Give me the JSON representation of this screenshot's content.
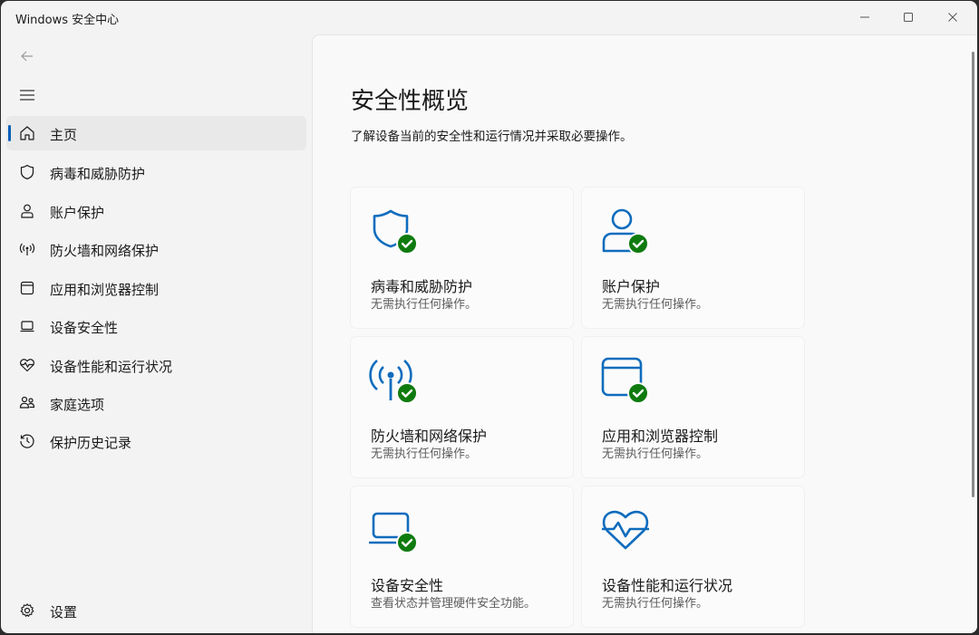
{
  "window": {
    "title": "Windows 安全中心",
    "controls": {
      "minimize": "minimize-icon",
      "maximize": "maximize-icon",
      "close": "close-icon"
    }
  },
  "nav": {
    "back_icon": "back-arrow-icon",
    "menu_icon": "hamburger-icon",
    "items": [
      {
        "label": "主页",
        "icon": "home-icon",
        "selected": true
      },
      {
        "label": "病毒和威胁防护",
        "icon": "shield-icon",
        "selected": false
      },
      {
        "label": "账户保护",
        "icon": "person-icon",
        "selected": false
      },
      {
        "label": "防火墙和网络保护",
        "icon": "antenna-icon",
        "selected": false
      },
      {
        "label": "应用和浏览器控制",
        "icon": "browser-window-icon",
        "selected": false
      },
      {
        "label": "设备安全性",
        "icon": "laptop-icon",
        "selected": false
      },
      {
        "label": "设备性能和运行状况",
        "icon": "heart-pulse-icon",
        "selected": false
      },
      {
        "label": "家庭选项",
        "icon": "family-icon",
        "selected": false
      },
      {
        "label": "保护历史记录",
        "icon": "history-icon",
        "selected": false
      }
    ],
    "settings": {
      "label": "设置",
      "icon": "gear-icon"
    }
  },
  "main": {
    "title": "安全性概览",
    "subtitle": "了解设备当前的安全性和运行情况并采取必要操作。",
    "cards": [
      {
        "title": "病毒和威胁防护",
        "status": "无需执行任何操作。",
        "icon": "shield-check-icon",
        "badge": "ok"
      },
      {
        "title": "账户保护",
        "status": "无需执行任何操作。",
        "icon": "person-check-icon",
        "badge": "ok"
      },
      {
        "title": "防火墙和网络保护",
        "status": "无需执行任何操作。",
        "icon": "antenna-check-icon",
        "badge": "ok"
      },
      {
        "title": "应用和浏览器控制",
        "status": "无需执行任何操作。",
        "icon": "browser-check-icon",
        "badge": "ok"
      },
      {
        "title": "设备安全性",
        "status": "查看状态并管理硬件安全功能。",
        "icon": "laptop-check-icon",
        "badge": "ok"
      },
      {
        "title": "设备性能和运行状况",
        "status": "无需执行任何操作。",
        "icon": "heart-pulse-icon",
        "badge": "none"
      }
    ]
  },
  "colors": {
    "accent": "#005fb8",
    "icon_blue": "#0f6cbd",
    "ok_green": "#0f7b0f",
    "selected_bg": "#e9e9e9"
  }
}
